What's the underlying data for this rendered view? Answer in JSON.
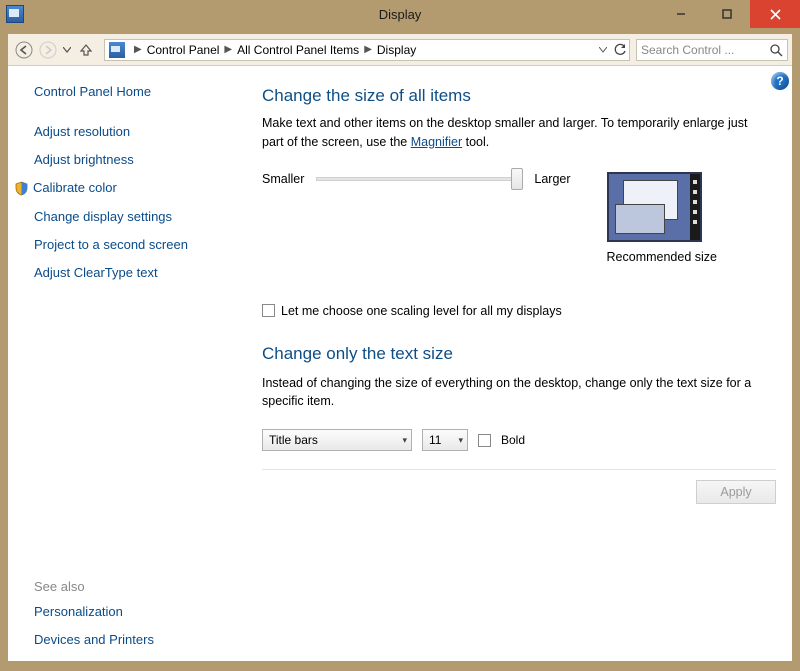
{
  "window": {
    "title": "Display"
  },
  "nav": {
    "crumbs": [
      "Control Panel",
      "All Control Panel Items",
      "Display"
    ],
    "search_placeholder": "Search Control ..."
  },
  "left": {
    "home": "Control Panel Home",
    "links": [
      "Adjust resolution",
      "Adjust brightness",
      "Calibrate color",
      "Change display settings",
      "Project to a second screen",
      "Adjust ClearType text"
    ],
    "see_also_heading": "See also",
    "see_also": [
      "Personalization",
      "Devices and Printers"
    ]
  },
  "main": {
    "heading_all": "Change the size of all items",
    "desc_all_a": "Make text and other items on the desktop smaller and larger. To temporarily enlarge just part of the screen, use the ",
    "magnifier": "Magnifier",
    "desc_all_b": " tool.",
    "smaller": "Smaller",
    "larger": "Larger",
    "recommended": "Recommended size",
    "one_scaling": "Let me choose one scaling level for all my displays",
    "heading_text": "Change only the text size",
    "desc_text": "Instead of changing the size of everything on the desktop, change only the text size for a specific item.",
    "item_selected": "Title bars",
    "size_selected": "11",
    "bold": "Bold",
    "apply": "Apply"
  }
}
